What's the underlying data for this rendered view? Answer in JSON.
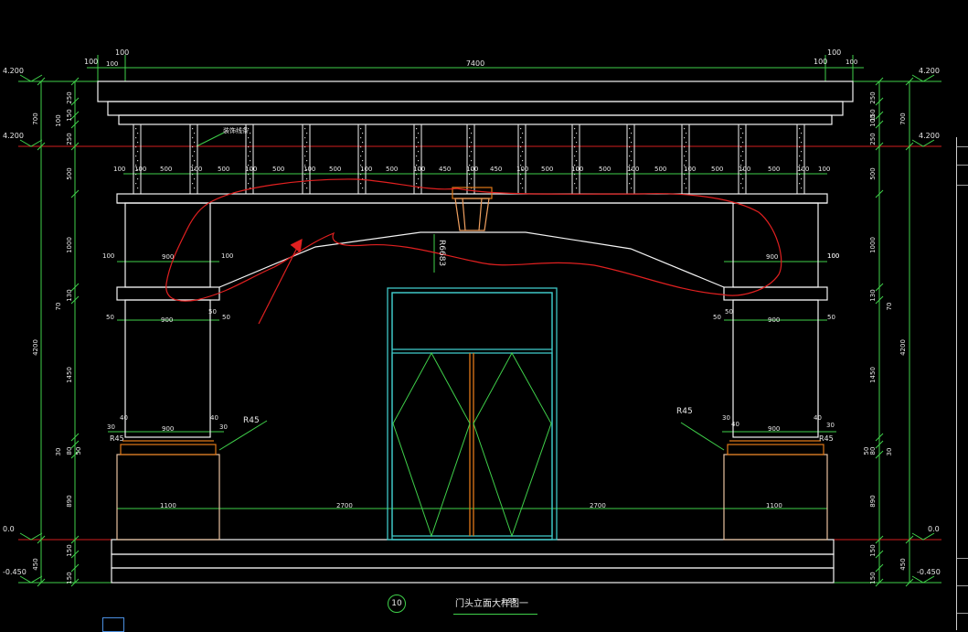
{
  "drawing": {
    "overall_width_dim": "7400",
    "levels": {
      "top_left": "4.200",
      "top_right": "4.200",
      "mid_left": "4.200",
      "mid_right": "4.200",
      "ground_left": "0.0",
      "ground_right": "0.0",
      "base_left": "-0.450",
      "base_right": "-0.450"
    },
    "left_vertical_dims": [
      "250",
      "150",
      "100",
      "4200",
      "700",
      "250",
      "500",
      "1000",
      "130",
      "70",
      "1450",
      "30",
      "80",
      "50",
      "890",
      "450",
      "150",
      "150"
    ],
    "right_vertical_dims": [
      "250",
      "150",
      "100",
      "700",
      "250",
      "500",
      "1000",
      "130",
      "70",
      "4200",
      "1450",
      "50",
      "80",
      "30",
      "890",
      "450",
      "150",
      "150"
    ],
    "top_corner_dims": [
      "100",
      "100",
      "100",
      "100"
    ],
    "grille_dims": [
      "100",
      "100",
      "500",
      "100",
      "500",
      "100",
      "500",
      "100",
      "500",
      "100",
      "500",
      "100",
      "450",
      "100",
      "450",
      "100",
      "500",
      "100",
      "500",
      "100",
      "500",
      "100",
      "500",
      "100",
      "500",
      "100",
      "100"
    ],
    "grille_note": "装饰线条",
    "upper_pilaster_dims": [
      "100",
      "900",
      "100",
      "100",
      "900",
      "100"
    ],
    "lower_pilaster_dims": [
      "50",
      "900",
      "50",
      "50",
      "900",
      "50"
    ],
    "base_cap_dims": [
      "30",
      "40",
      "900",
      "40",
      "30",
      "30",
      "40",
      "900",
      "40",
      "30"
    ],
    "fillet_labels": [
      "R45",
      "R45",
      "R45",
      "R45"
    ],
    "arch_radius": "R6683",
    "bottom_dims": [
      "1100",
      "2700",
      "2700",
      "1100"
    ]
  },
  "caption": {
    "number": "10",
    "title": "门头立面大样图一",
    "scale": "1:25"
  },
  "colors": {
    "outline": "#f4f4f4",
    "dimension": "#3fd04a",
    "level_line": "#d21e1e",
    "markup": "#e02020",
    "door": "#3fc6c6",
    "accent": "#e07818"
  }
}
